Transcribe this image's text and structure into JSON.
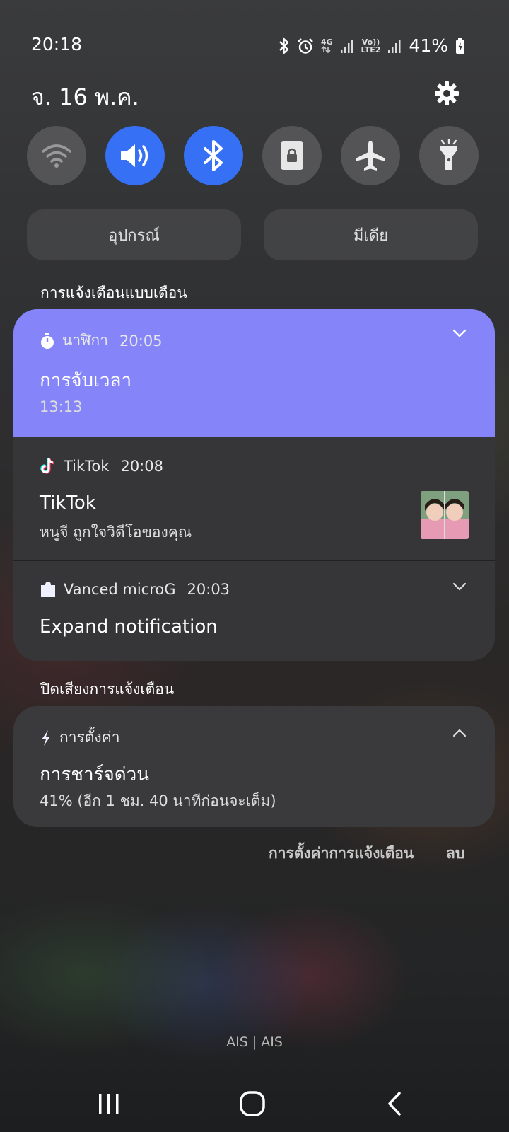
{
  "status_bar": {
    "time": "20:18",
    "network_1": "4G",
    "network_2_top": "Vo))",
    "network_2_bottom": "LTE2",
    "battery": "41%",
    "icons": [
      "bluetooth-icon",
      "alarm-icon",
      "data-arrows-icon",
      "signal-icon",
      "signal-icon",
      "battery-charging-icon"
    ]
  },
  "header": {
    "date": "จ. 16 พ.ค."
  },
  "quick_settings": {
    "toggles": [
      {
        "name": "wifi",
        "icon": "wifi-icon",
        "on": false
      },
      {
        "name": "sound",
        "icon": "volume-icon",
        "on": true
      },
      {
        "name": "bluetooth",
        "icon": "bluetooth-icon",
        "on": true
      },
      {
        "name": "rotation-lock",
        "icon": "lock-rotation-icon",
        "on": false
      },
      {
        "name": "airplane",
        "icon": "airplane-icon",
        "on": false
      },
      {
        "name": "flashlight",
        "icon": "flashlight-icon",
        "on": false
      }
    ],
    "accent_color": "#3671f5",
    "devices_label": "อุปกรณ์",
    "media_label": "มีเดีย"
  },
  "alert_section": {
    "label": "การแจ้งเตือนแบบเตือน",
    "notifications": [
      {
        "app": "นาฬิกา",
        "time": "20:05",
        "title": "การจับเวลา",
        "text": "13:13",
        "color": "#8585f9"
      },
      {
        "app": "TikTok",
        "time": "20:08",
        "title": "TikTok",
        "text": "หนูจี ถูกใจวิดีโอของคุณ"
      },
      {
        "app": "Vanced microG",
        "time": "20:03",
        "title": "Expand notification"
      }
    ]
  },
  "silent_section": {
    "label": "ปิดเสียงการแจ้งเตือน",
    "notification": {
      "app": "การตั้งค่า",
      "title": "การชาร์จด่วน",
      "text": "41% (อีก 1 ชม. 40 นาทีก่อนจะเต็ม)"
    }
  },
  "actions": {
    "notification_settings": "การตั้งค่าการแจ้งเตือน",
    "clear": "ลบ"
  },
  "carrier": "AIS | AIS"
}
